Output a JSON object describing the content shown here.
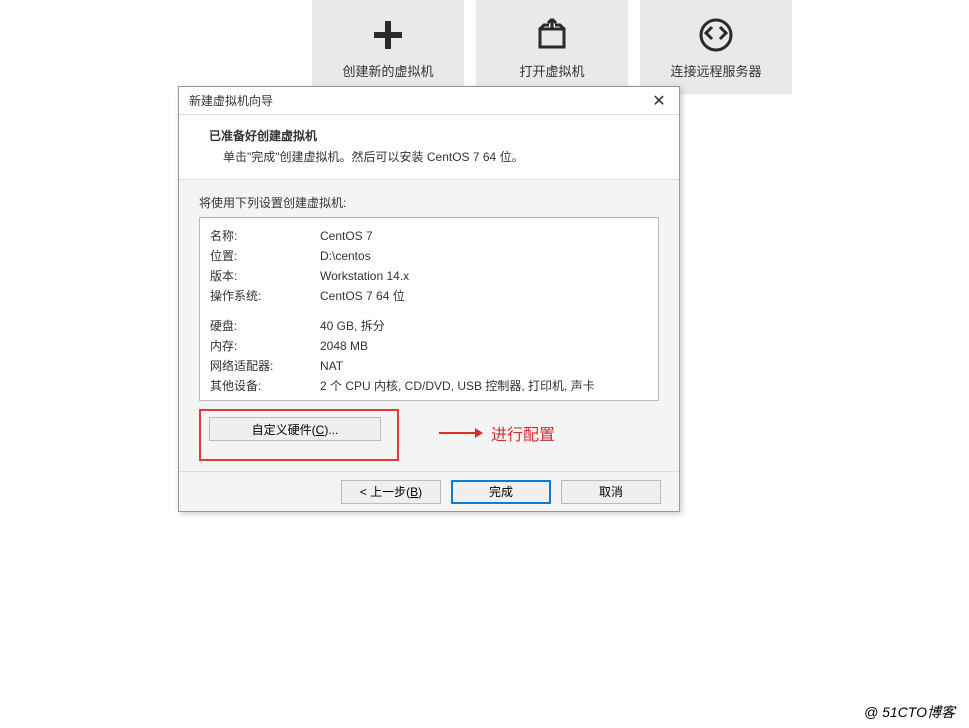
{
  "toolbar": {
    "cards": [
      {
        "id": "new-vm",
        "label": "创建新的虚拟机",
        "icon": "plus"
      },
      {
        "id": "open-vm",
        "label": "打开虚拟机",
        "icon": "open-box"
      },
      {
        "id": "connect-remote",
        "label": "连接远程服务器",
        "icon": "remote-arrows"
      }
    ]
  },
  "dialog": {
    "title": "新建虚拟机向导",
    "close_glyph": "✕",
    "heading": "已准备好创建虚拟机",
    "subheading": "单击\"完成\"创建虚拟机。然后可以安装 CentOS 7 64 位。",
    "body_label": "将使用下列设置创建虚拟机:",
    "settings": [
      {
        "k": "名称:",
        "v": "CentOS 7"
      },
      {
        "k": "位置:",
        "v": "D:\\centos"
      },
      {
        "k": "版本:",
        "v": "Workstation 14.x"
      },
      {
        "k": "操作系统:",
        "v": "CentOS 7 64 位"
      }
    ],
    "settings2": [
      {
        "k": "硬盘:",
        "v": "40 GB, 拆分"
      },
      {
        "k": "内存:",
        "v": "2048 MB"
      },
      {
        "k": "网络适配器:",
        "v": "NAT"
      },
      {
        "k": "其他设备:",
        "v": "2 个 CPU 内核, CD/DVD, USB 控制器, 打印机, 声卡"
      }
    ],
    "custom_hw_prefix": "自定义硬件(",
    "custom_hw_key": "C",
    "custom_hw_suffix": ")...",
    "back_prefix": "< 上一步(",
    "back_key": "B",
    "back_suffix": ")",
    "finish_label": "完成",
    "cancel_label": "取消"
  },
  "annotation": {
    "text": "进行配置"
  },
  "watermark": "@ 51CTO博客"
}
